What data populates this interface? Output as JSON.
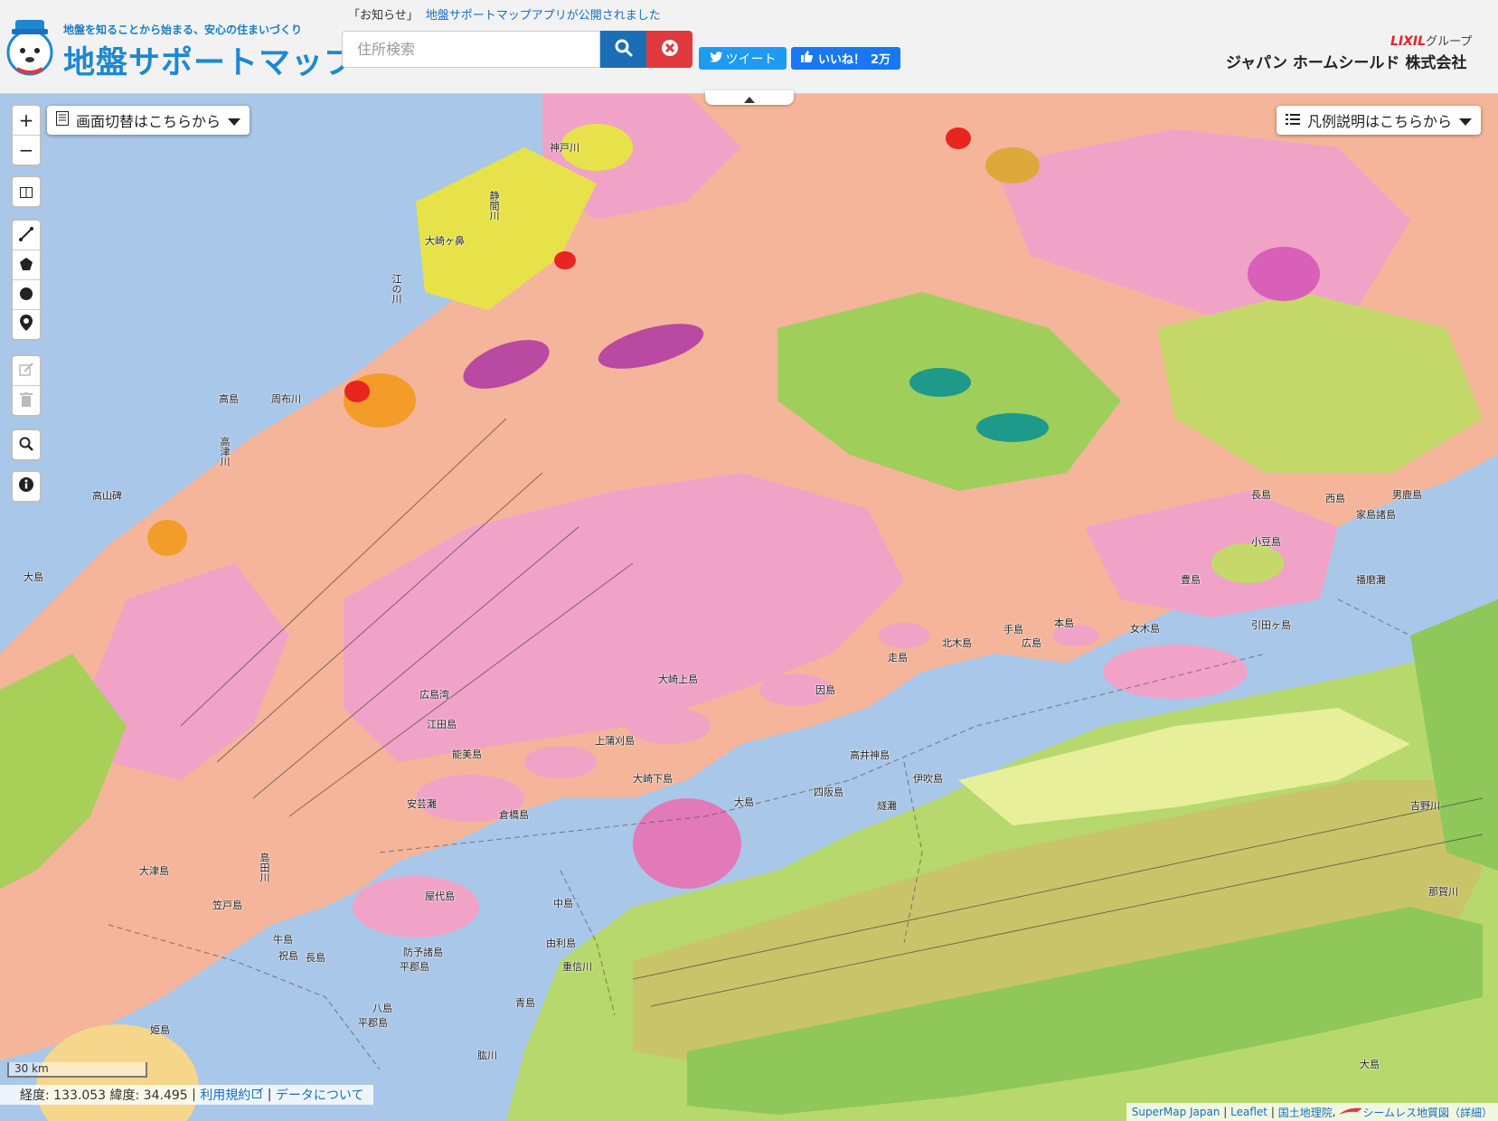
{
  "header": {
    "tagline": "地盤を知ることから始まる、安心の住まいづくり",
    "brand": "地盤サポートマップ",
    "news_tag": "「お知らせ」",
    "news_link": "地盤サポートマップアプリが公開されました",
    "search_placeholder": "住所検索",
    "tweet_label": "ツイート",
    "like_label": "いいね！",
    "like_count": "2万",
    "group_logo": "LIXIL",
    "group_suffix": "グループ",
    "company": "ジャパン ホームシールド 株式会社"
  },
  "map": {
    "view_switch": "画面切替はこちらから",
    "legend": "凡例説明はこちらから",
    "scale": "30 km",
    "coords": "経度: 133.053 緯度: 34.495",
    "terms_link": "利用規約",
    "data_link": "データについて",
    "attribution": {
      "supermap": "SuperMap Japan",
      "leaflet": "Leaflet",
      "gsi": "国土地理院",
      "seamless": "シームレス地質図（詳細）"
    },
    "places": [
      {
        "name": "神戸川",
        "vert": false
      },
      {
        "name": "静間川",
        "vert": true
      },
      {
        "name": "大崎ヶ鼻",
        "vert": false
      },
      {
        "name": "江の川",
        "vert": true
      },
      {
        "name": "高島",
        "vert": false
      },
      {
        "name": "周布川",
        "vert": false
      },
      {
        "name": "高津川",
        "vert": true
      },
      {
        "name": "高山碑",
        "vert": false
      },
      {
        "name": "大島",
        "vert": false
      },
      {
        "name": "広島湾",
        "vert": false
      },
      {
        "name": "江田島",
        "vert": false
      },
      {
        "name": "能美島",
        "vert": false
      },
      {
        "name": "倉橋島",
        "vert": false
      },
      {
        "name": "安芸灘",
        "vert": false
      },
      {
        "name": "上蒲刈島",
        "vert": false
      },
      {
        "name": "大崎下島",
        "vert": false
      },
      {
        "name": "大崎上島",
        "vert": false
      },
      {
        "name": "高井神島",
        "vert": false
      },
      {
        "name": "伊吹島",
        "vert": false
      },
      {
        "name": "四阪島",
        "vert": false
      },
      {
        "name": "燧灘",
        "vert": false
      },
      {
        "name": "因島",
        "vert": false
      },
      {
        "name": "走島",
        "vert": false
      },
      {
        "name": "北木島",
        "vert": false
      },
      {
        "name": "手島",
        "vert": false
      },
      {
        "name": "広島",
        "vert": false
      },
      {
        "name": "本島",
        "vert": false
      },
      {
        "name": "女木島",
        "vert": false
      },
      {
        "name": "豊島",
        "vert": false
      },
      {
        "name": "小豆島",
        "vert": false
      },
      {
        "name": "長島",
        "vert": false
      },
      {
        "name": "西島",
        "vert": false
      },
      {
        "name": "男鹿島",
        "vert": false
      },
      {
        "name": "家島諸島",
        "vert": false
      },
      {
        "name": "播磨灘",
        "vert": false
      },
      {
        "name": "引田ヶ島",
        "vert": false
      },
      {
        "name": "吉野川",
        "vert": false
      },
      {
        "name": "那賀川",
        "vert": false
      },
      {
        "name": "大島",
        "vert": false
      },
      {
        "name": "屋代島",
        "vert": false
      },
      {
        "name": "防予諸島",
        "vert": false
      },
      {
        "name": "平郡島",
        "vert": false
      },
      {
        "name": "中島",
        "vert": false
      },
      {
        "name": "由利島",
        "vert": false
      },
      {
        "name": "重信川",
        "vert": false
      },
      {
        "name": "青島",
        "vert": false
      },
      {
        "name": "祝島",
        "vert": false
      },
      {
        "name": "牛島",
        "vert": false
      },
      {
        "name": "長島",
        "vert": false
      },
      {
        "name": "笠戸島",
        "vert": false
      },
      {
        "name": "大津島",
        "vert": false
      },
      {
        "name": "姫島",
        "vert": false
      },
      {
        "name": "八島",
        "vert": false
      },
      {
        "name": "平郡島",
        "vert": false
      },
      {
        "name": "肱川",
        "vert": false
      },
      {
        "name": "大島",
        "vert": false
      },
      {
        "name": "島田川",
        "vert": true
      }
    ]
  }
}
